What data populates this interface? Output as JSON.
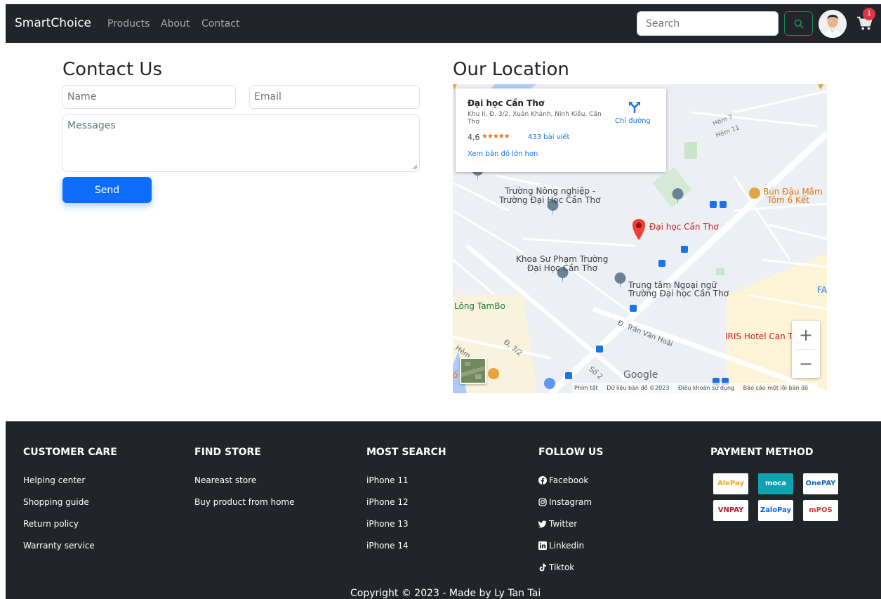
{
  "navbar": {
    "brand": "SmartChoice",
    "links": [
      "Products",
      "About",
      "Contact"
    ],
    "search_placeholder": "Search",
    "cart_count": "1"
  },
  "contact": {
    "title": "Contact Us",
    "name_placeholder": "Name",
    "email_placeholder": "Email",
    "message_placeholder": "Messages",
    "send_label": "Send"
  },
  "location": {
    "title": "Our Location",
    "card": {
      "place": "Đại học Cần Thơ",
      "address": "Khu II, Đ. 3/2, Xuân Khánh, Ninh Kiều, Cần Thơ",
      "rating": "4,6",
      "stars": "★★★★★",
      "reviews": "433 bài viết",
      "bigger_map": "Xem bản đồ lớn hơn",
      "directions": "Chỉ đường"
    },
    "labels": {
      "nong_nghiep": "Trường Nông nghiệp -",
      "nong_nghiep2": "Trường Đại Học Cần Thơ",
      "bun_dau": "Bún Đậu Mắm",
      "bun_dau2": "Tôm 6 Kết",
      "dhct": "Đại học Cần Thơ",
      "su_pham": "Khoa Sư Phạm Trường",
      "su_pham2": "Đại Học Cần Thơ",
      "ngoai_ngu": "Trung tâm Ngoại ngữ",
      "ngoai_ngu2": "Trường Đại học Cần Thơ",
      "tambo": "Lông TamBo",
      "tran_van_hoai": "Đ. Trần Văn Hoài",
      "d32": "Đ. 3/2",
      "iris": "IRIS Hotel Can T",
      "hem7": "Hẻm 7",
      "hem11": "Hẻm 11",
      "fa": "FA",
      "so2": "Số 2",
      "hem": "Hẻm",
      "o": "ố"
    },
    "zoom_in": "+",
    "zoom_out": "−",
    "google": "Google",
    "attribution": [
      "Phím tắt",
      "Dữ liệu bản đồ ©2023",
      "Điều khoản sử dụng",
      "Báo cáo một lỗi bản đồ"
    ]
  },
  "footer": {
    "columns": [
      {
        "title": "CUSTOMER CARE",
        "links": [
          "Helping center",
          "Shopping guide",
          "Return policy",
          "Warranty service"
        ]
      },
      {
        "title": "FIND STORE",
        "links": [
          "Neareast store",
          "Buy product from home"
        ]
      },
      {
        "title": "MOST SEARCH",
        "links": [
          "iPhone 11",
          "iPhone 12",
          "iPhone 13",
          "iPhone 14"
        ]
      },
      {
        "title": "FOLLOW US",
        "links": [
          "Facebook",
          "Instagram",
          "Twitter",
          "Linkedin",
          "Tiktok"
        ]
      },
      {
        "title": "PAYMENT METHOD",
        "methods": [
          "AlePay",
          "moca",
          "OnePAY",
          "VNPAY",
          "ZaloPay",
          "mPOS"
        ]
      }
    ],
    "copyright": "Copyright © 2023 - Made by Ly Tan Tai"
  },
  "colors": {
    "navbar_bg": "#212529",
    "primary": "#0d6efd",
    "success": "#198754",
    "danger": "#dc3545"
  }
}
